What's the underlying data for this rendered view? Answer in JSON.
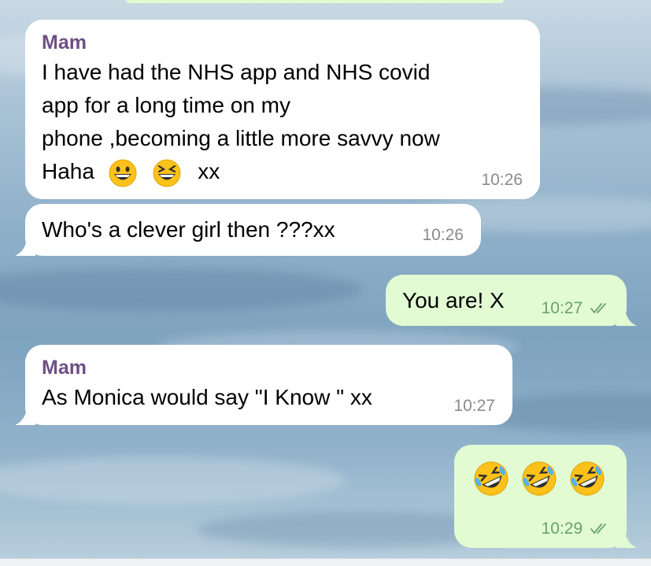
{
  "chat": {
    "messages": [
      {
        "direction": "incoming",
        "sender": "Mam",
        "lines": [
          "I have had the NHS app and NHS covid",
          "app for a long time on my",
          "phone ,becoming a little more savvy now"
        ],
        "last_line_text": "Haha",
        "emojis": [
          "grinning-face-emoji",
          "laughing-squinting-face-emoji"
        ],
        "trailing_text": "xx",
        "time": "10:26"
      },
      {
        "direction": "incoming",
        "text": "Who's a clever girl then ???xx",
        "time": "10:26"
      },
      {
        "direction": "outgoing",
        "text": "You are! X",
        "time": "10:27",
        "status": "read-double-check"
      },
      {
        "direction": "incoming",
        "sender": "Mam",
        "text": "As Monica would say \"I Know \" xx",
        "time": "10:27"
      },
      {
        "direction": "outgoing",
        "emojis": [
          "rolling-on-floor-laughing-emoji",
          "rolling-on-floor-laughing-emoji",
          "rolling-on-floor-laughing-emoji"
        ],
        "time": "10:29",
        "status": "read-double-check"
      }
    ]
  },
  "colors": {
    "incoming_bubble": "#ffffff",
    "outgoing_bubble": "#e2fbd3",
    "sender_name": "#6f4e86",
    "timestamp": "#8a8a8a",
    "outgoing_timestamp": "#6aa06a"
  }
}
